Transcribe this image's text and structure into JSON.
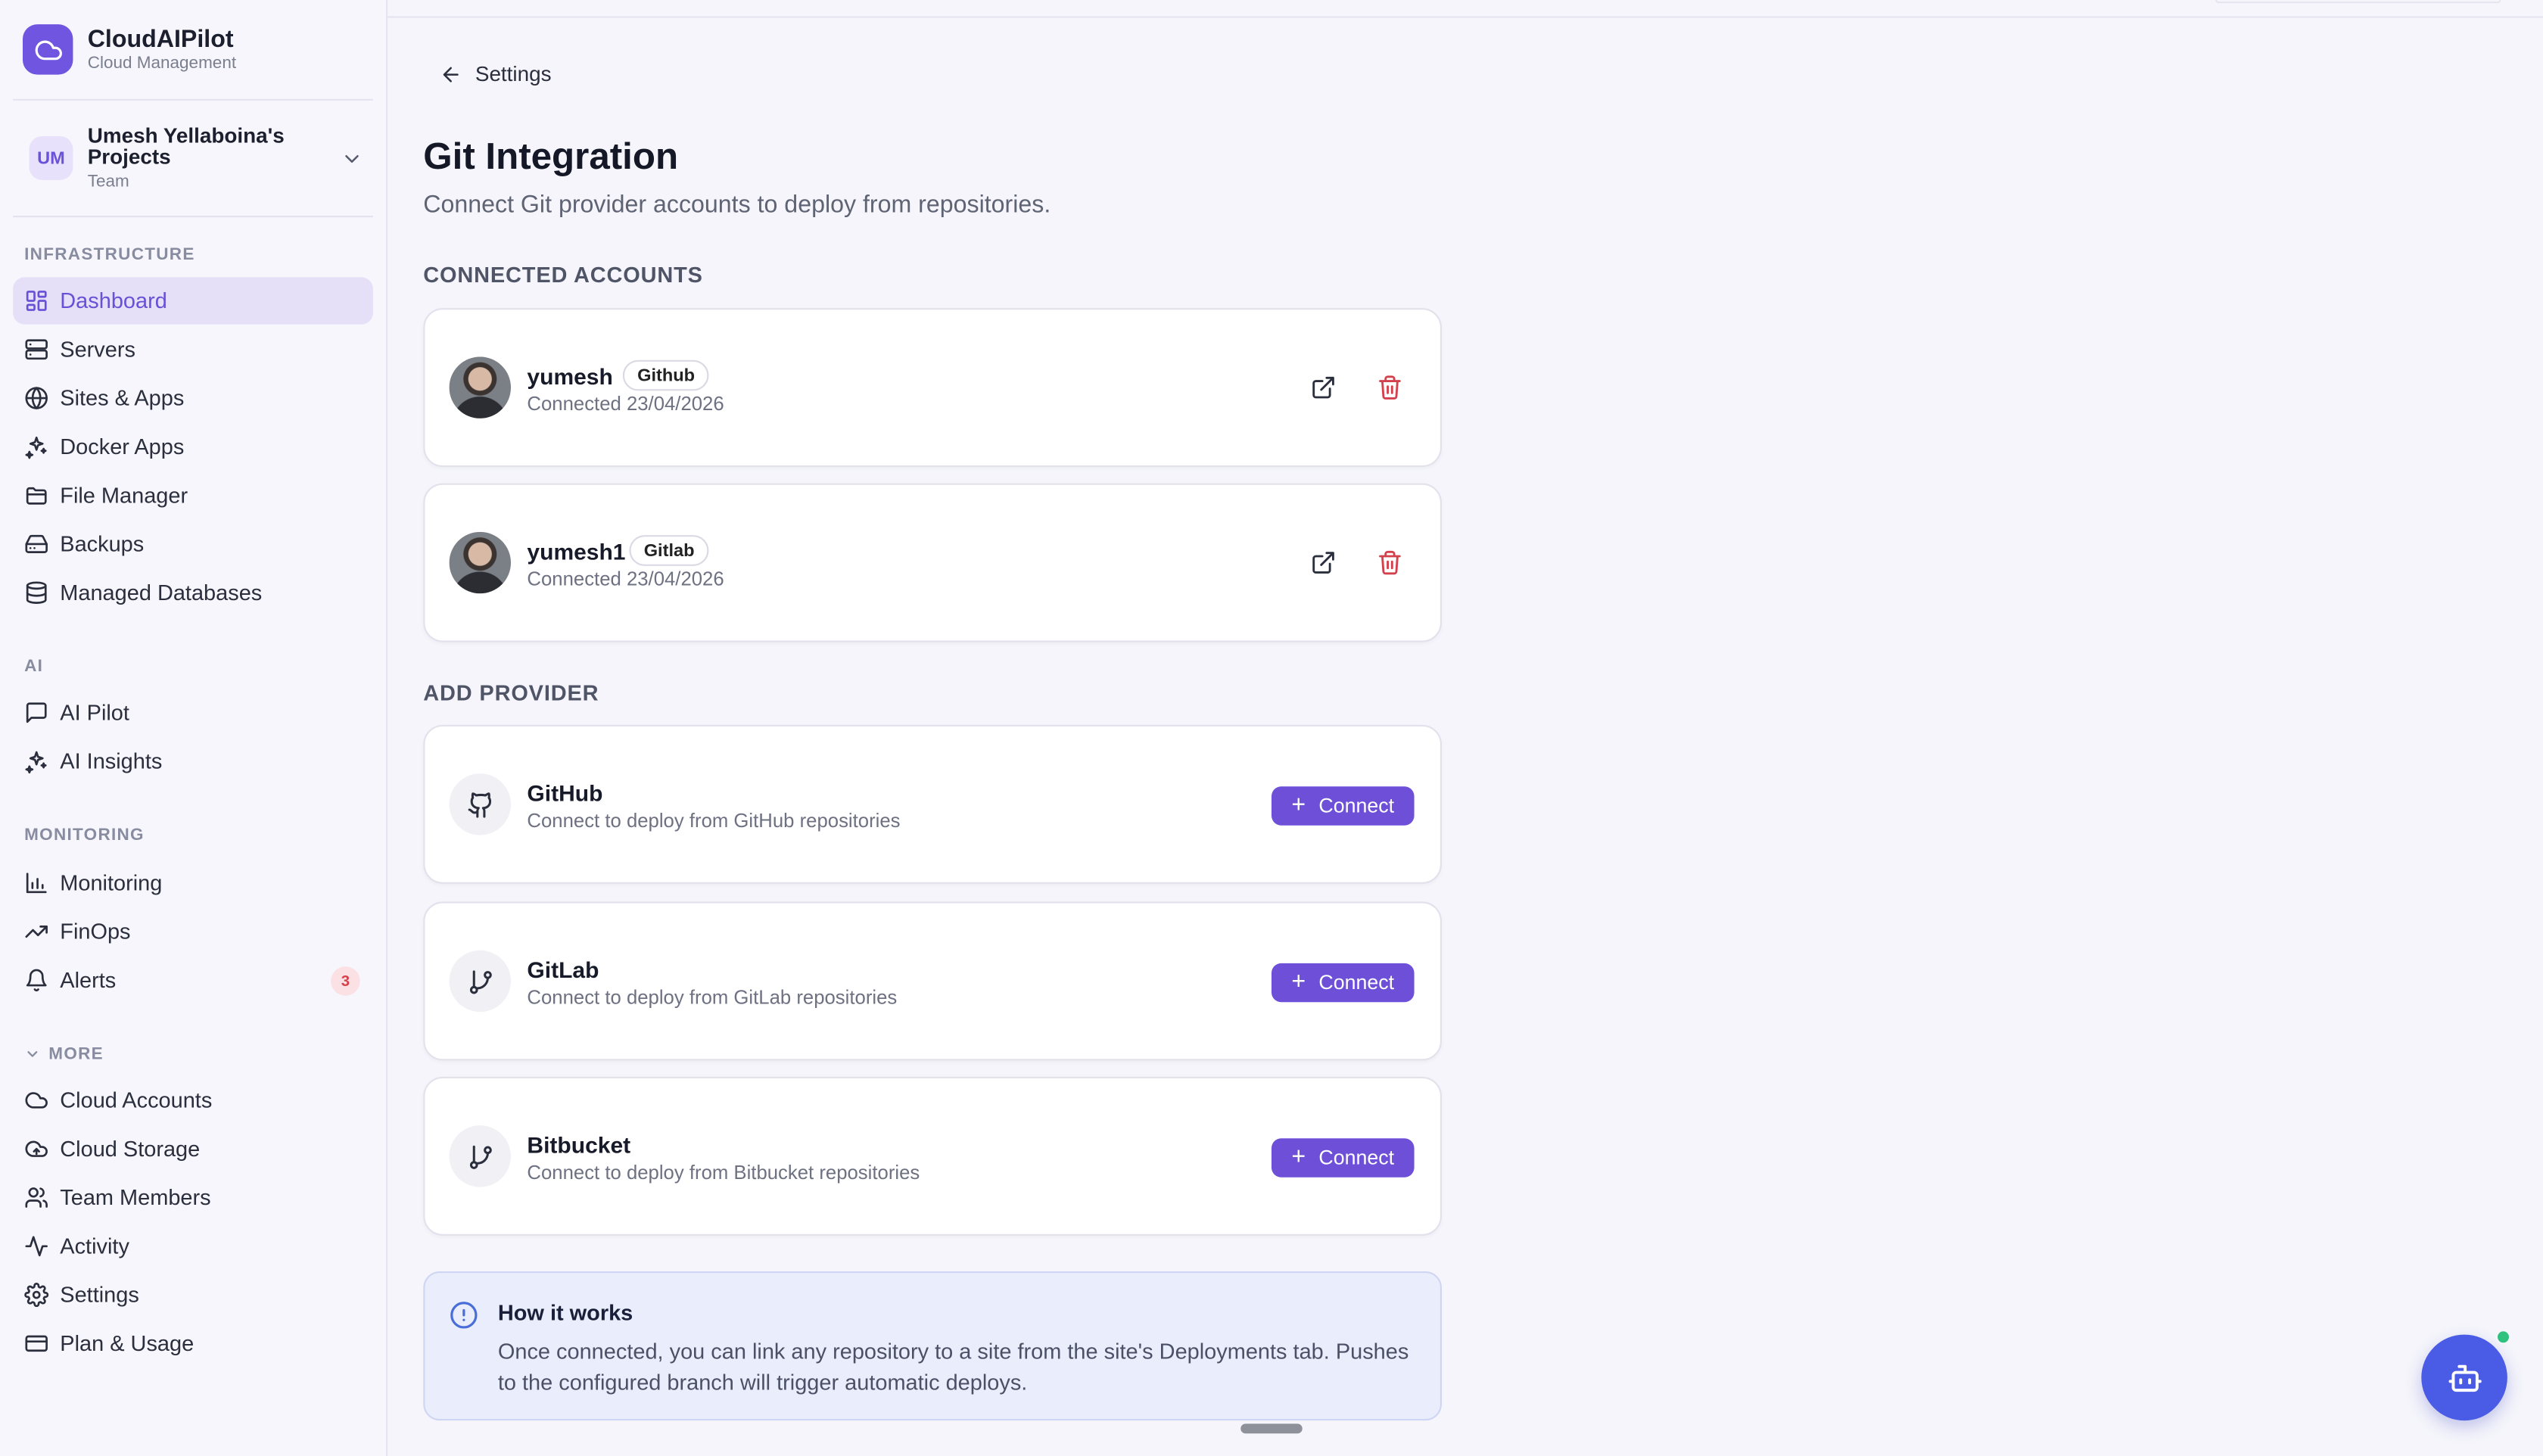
{
  "brand": {
    "name": "CloudAIPilot",
    "subtitle": "Cloud Management"
  },
  "team": {
    "initials": "UM",
    "name": "Umesh Yellaboina's Projects",
    "role": "Team"
  },
  "sidebar": {
    "sections": {
      "infrastructure": "INFRASTRUCTURE",
      "ai": "AI",
      "monitoring": "MONITORING",
      "more": "MORE"
    },
    "infrastructure": [
      {
        "label": "Dashboard",
        "icon": "dashboard-icon",
        "active": true
      },
      {
        "label": "Servers",
        "icon": "server-icon"
      },
      {
        "label": "Sites & Apps",
        "icon": "globe-icon"
      },
      {
        "label": "Docker Apps",
        "icon": "docker-icon"
      },
      {
        "label": "File Manager",
        "icon": "folder-icon"
      },
      {
        "label": "Backups",
        "icon": "hard-drive-icon"
      },
      {
        "label": "Managed Databases",
        "icon": "database-icon"
      }
    ],
    "ai": [
      {
        "label": "AI Pilot",
        "icon": "message-icon"
      },
      {
        "label": "AI Insights",
        "icon": "sparkles-icon"
      }
    ],
    "monitoring": [
      {
        "label": "Monitoring",
        "icon": "bar-chart-icon"
      },
      {
        "label": "FinOps",
        "icon": "trending-up-icon"
      },
      {
        "label": "Alerts",
        "icon": "bell-icon",
        "badge": "3"
      }
    ],
    "more": [
      {
        "label": "Cloud Accounts",
        "icon": "cloud-icon"
      },
      {
        "label": "Cloud Storage",
        "icon": "cloud-storage-icon"
      },
      {
        "label": "Team Members",
        "icon": "users-icon"
      },
      {
        "label": "Activity",
        "icon": "activity-icon"
      },
      {
        "label": "Settings",
        "icon": "gear-icon"
      },
      {
        "label": "Plan & Usage",
        "icon": "credit-card-icon"
      }
    ]
  },
  "header": {
    "back_label": "Settings"
  },
  "page": {
    "title": "Git Integration",
    "subtitle": "Connect Git provider accounts to deploy from repositories."
  },
  "connected": {
    "label": "CONNECTED ACCOUNTS",
    "accounts": [
      {
        "username": "yumesh",
        "provider": "Github",
        "connected": "Connected 23/04/2026"
      },
      {
        "username": "yumesh1",
        "provider": "Gitlab",
        "connected": "Connected 23/04/2026"
      }
    ]
  },
  "add_provider": {
    "label": "ADD PROVIDER",
    "connect_label": "Connect",
    "providers": [
      {
        "name": "GitHub",
        "description": "Connect to deploy from GitHub repositories",
        "icon": "github-icon"
      },
      {
        "name": "GitLab",
        "description": "Connect to deploy from GitLab repositories",
        "icon": "git-branch-icon"
      },
      {
        "name": "Bitbucket",
        "description": "Connect to deploy from Bitbucket repositories",
        "icon": "git-branch-icon"
      }
    ]
  },
  "info": {
    "title": "How it works",
    "body": "Once connected, you can link any repository to a site from the site's Deployments tab. Pushes to the configured branch will trigger automatic deploys."
  },
  "colors": {
    "accent": "#6d4fd8",
    "danger": "#d4404c",
    "fab": "#4a5ce6",
    "online": "#2ec27e"
  }
}
